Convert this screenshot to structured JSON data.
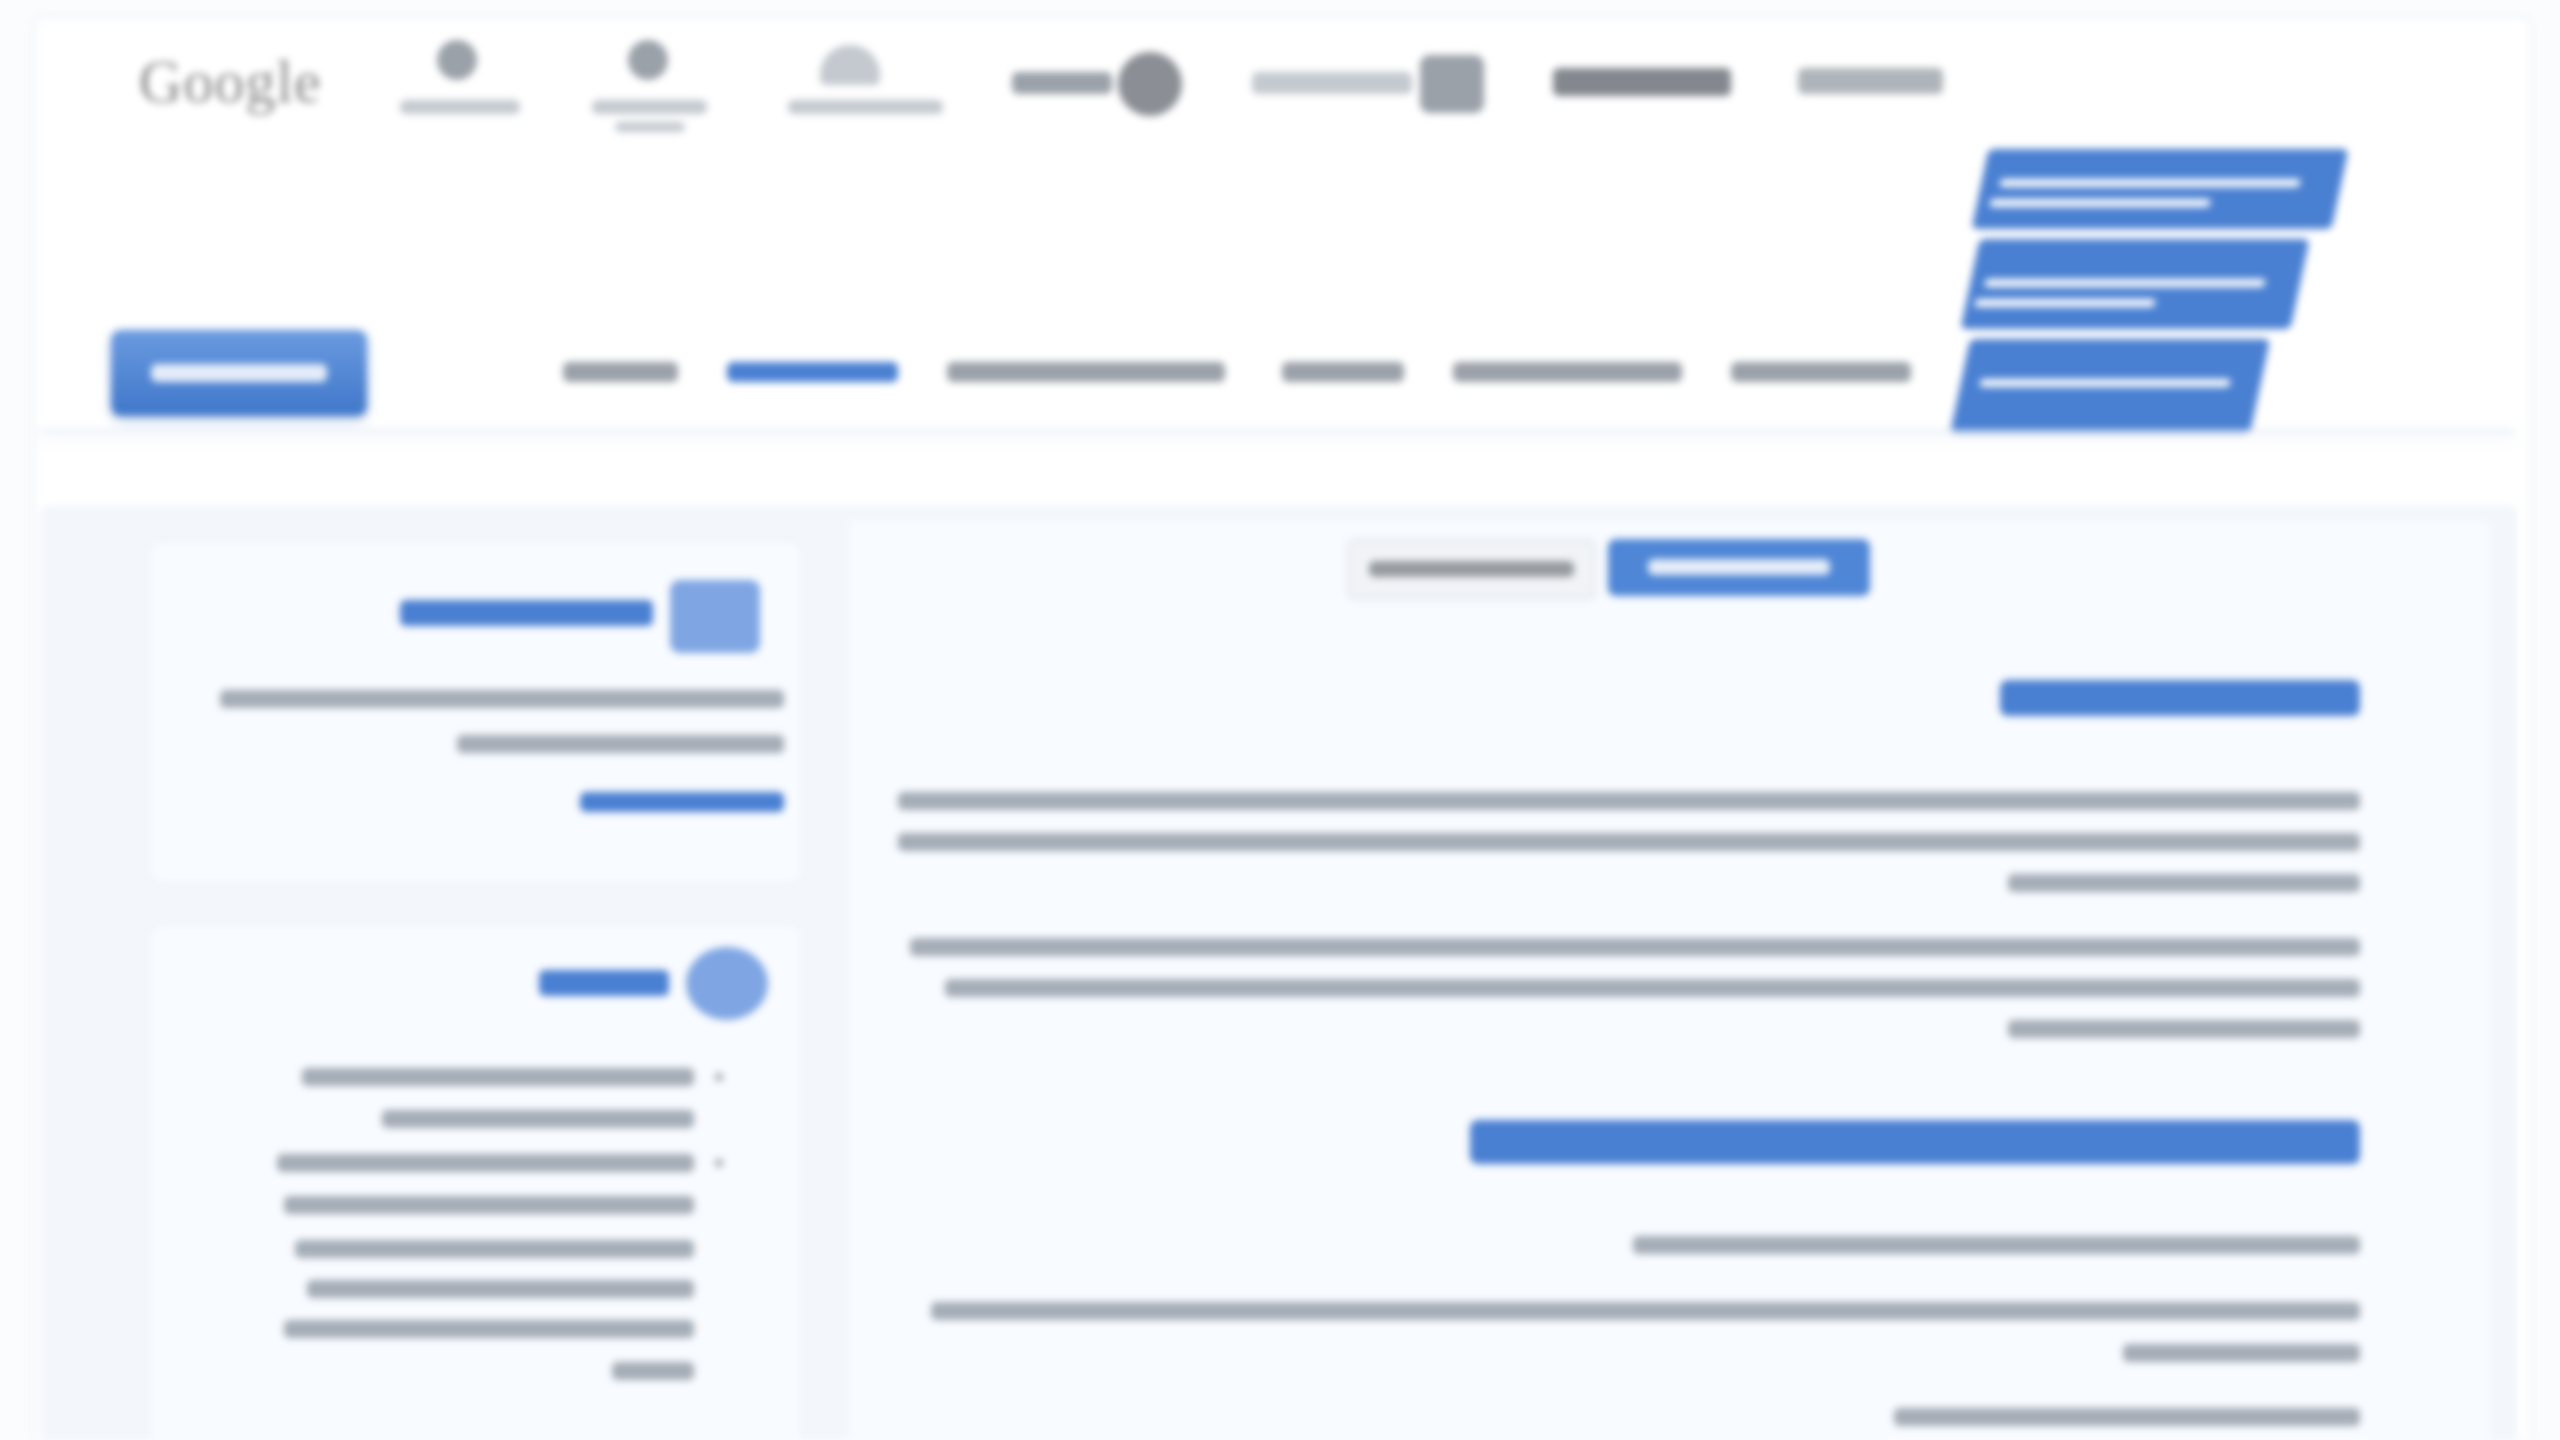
{
  "colors": {
    "accent": "#4a80d2",
    "background": "#f3f7fc",
    "nav_text": "#9aa1a9",
    "body_text": "#a4acb6"
  },
  "header": {
    "partner_logos": [
      {
        "text": "Google",
        "icon": "google-wordmark"
      },
      {
        "icon": "person-badge-icon"
      },
      {
        "icon": "person-badge-icon"
      },
      {
        "icon": "emblem-icon"
      },
      {
        "icon": "circle-mark-icon"
      },
      {
        "icon": "square-mark-icon"
      },
      {
        "icon": "wordmark-icon"
      },
      {
        "icon": "wordmark-icon"
      }
    ],
    "brand_logo_icon": "brand-logo",
    "nav": {
      "active_index": 1,
      "item_count": 6
    }
  },
  "main": {
    "tabs": {
      "active_index": 0,
      "count": 2
    }
  },
  "sidebar": {
    "cards": [
      {
        "icon": "document-icon"
      },
      {
        "icon": "info-circle-icon"
      }
    ]
  }
}
